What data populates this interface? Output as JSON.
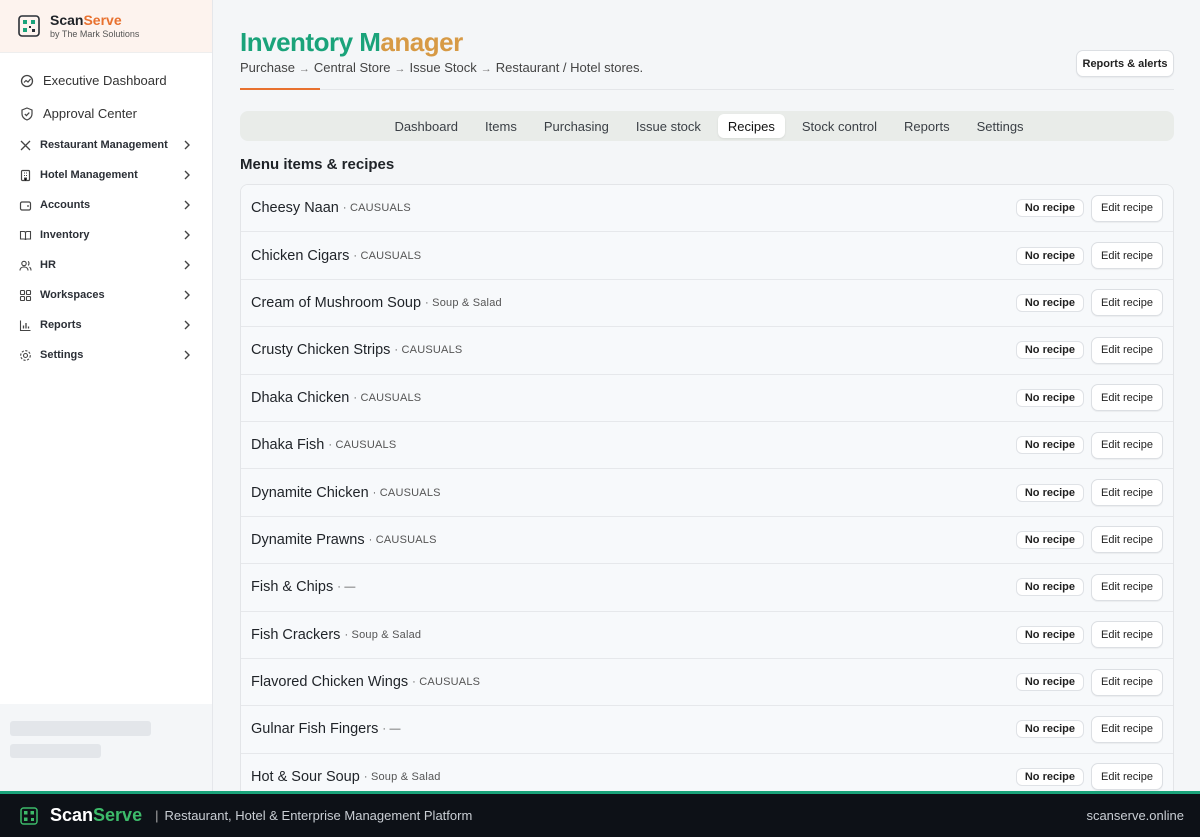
{
  "brand": {
    "name_a": "Scan",
    "name_b": "Serve",
    "subtitle": "by The Mark Solutions"
  },
  "nav": {
    "top": [
      {
        "label": "Executive Dashboard",
        "icon": "activity-icon"
      },
      {
        "label": "Approval Center",
        "icon": "shield-check-icon"
      }
    ],
    "sections": [
      {
        "label": "Restaurant Management",
        "icon": "utensils-icon"
      },
      {
        "label": "Hotel Management",
        "icon": "building-icon"
      },
      {
        "label": "Accounts",
        "icon": "wallet-icon"
      },
      {
        "label": "Inventory",
        "icon": "book-open-icon"
      },
      {
        "label": "HR",
        "icon": "users-icon"
      },
      {
        "label": "Workspaces",
        "icon": "grid-icon"
      },
      {
        "label": "Reports",
        "icon": "bar-chart-icon"
      },
      {
        "label": "Settings",
        "icon": "gear-icon"
      }
    ]
  },
  "header": {
    "title_a": "Inventory M",
    "title_b": "anager",
    "breadcrumb": [
      "Purchase",
      "Central Store",
      "Issue Stock",
      "Restaurant / Hotel stores."
    ],
    "arrow": "→",
    "reports_button": "Reports & alerts"
  },
  "tabs": [
    "Dashboard",
    "Items",
    "Purchasing",
    "Issue stock",
    "Recipes",
    "Stock control",
    "Reports",
    "Settings"
  ],
  "active_tab": "Recipes",
  "section_title": "Menu items & recipes",
  "rows": [
    {
      "name": "Cheesy Naan",
      "category": "· CAUSUALS"
    },
    {
      "name": "Chicken Cigars",
      "category": "· CAUSUALS"
    },
    {
      "name": "Cream of Mushroom Soup",
      "category": "· Soup & Salad"
    },
    {
      "name": "Crusty Chicken Strips",
      "category": "· CAUSUALS"
    },
    {
      "name": "Dhaka Chicken",
      "category": "· CAUSUALS"
    },
    {
      "name": "Dhaka Fish",
      "category": "· CAUSUALS"
    },
    {
      "name": "Dynamite Chicken",
      "category": "· CAUSUALS"
    },
    {
      "name": "Dynamite Prawns",
      "category": "· CAUSUALS"
    },
    {
      "name": "Fish & Chips",
      "category": "· —"
    },
    {
      "name": "Fish Crackers",
      "category": "· Soup & Salad"
    },
    {
      "name": "Flavored Chicken Wings",
      "category": "· CAUSUALS"
    },
    {
      "name": "Gulnar Fish Fingers",
      "category": "· —"
    },
    {
      "name": "Hot & Sour Soup",
      "category": "· Soup & Salad"
    }
  ],
  "row_badge": "No recipe",
  "row_button": "Edit recipe",
  "footer": {
    "brand_a": "Scan",
    "brand_b": "Serve",
    "separator": "|",
    "tagline": "Restaurant, Hotel & Enterprise Management Platform",
    "domain": "scanserve.online"
  },
  "colors": {
    "accent_orange": "#e8712f",
    "accent_green": "#1aa37a",
    "title_gold": "#d79a45",
    "footer_bg": "#0d1117"
  }
}
